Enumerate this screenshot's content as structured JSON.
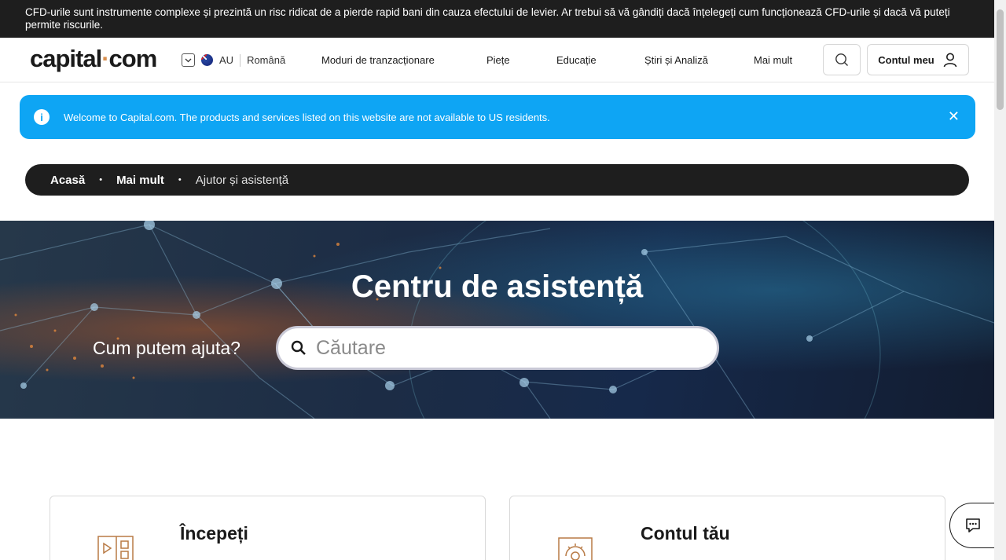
{
  "risk_warning": "CFD-urile sunt instrumente complexe și prezintă un risc ridicat de a pierde rapid bani din cauza efectului de levier. Ar trebui să vă gândiți dacă înțelegeți cum funcționează CFD-urile și dacă vă puteți permite riscurile.",
  "header": {
    "logo_left": "capital",
    "logo_dot": "·",
    "logo_right": "com",
    "region_code": "AU",
    "language": "Română",
    "nav": [
      "Moduri de tranzacționare",
      "Piețe",
      "Educație",
      "Știri și Analiză",
      "Mai mult"
    ],
    "account_label": "Contul meu"
  },
  "notice": {
    "info_glyph": "i",
    "text": "Welcome to Capital.com. The products and services listed on this website are not available to US residents.",
    "close_glyph": "✕"
  },
  "breadcrumb": {
    "items": [
      "Acasă",
      "Mai mult"
    ],
    "current": "Ajutor și asistență",
    "bullet": "•"
  },
  "hero": {
    "title": "Centru de asistență",
    "prompt": "Cum putem ajuta?",
    "search_placeholder": "Căutare"
  },
  "cards": [
    {
      "title": "Începeți",
      "icon": "video-tutorial-icon"
    },
    {
      "title": "Contul tău",
      "icon": "account-settings-icon"
    }
  ],
  "colors": {
    "accent_orange": "#d88f4e",
    "notice_blue": "#0ea5f4",
    "dark": "#1e1e1e"
  }
}
